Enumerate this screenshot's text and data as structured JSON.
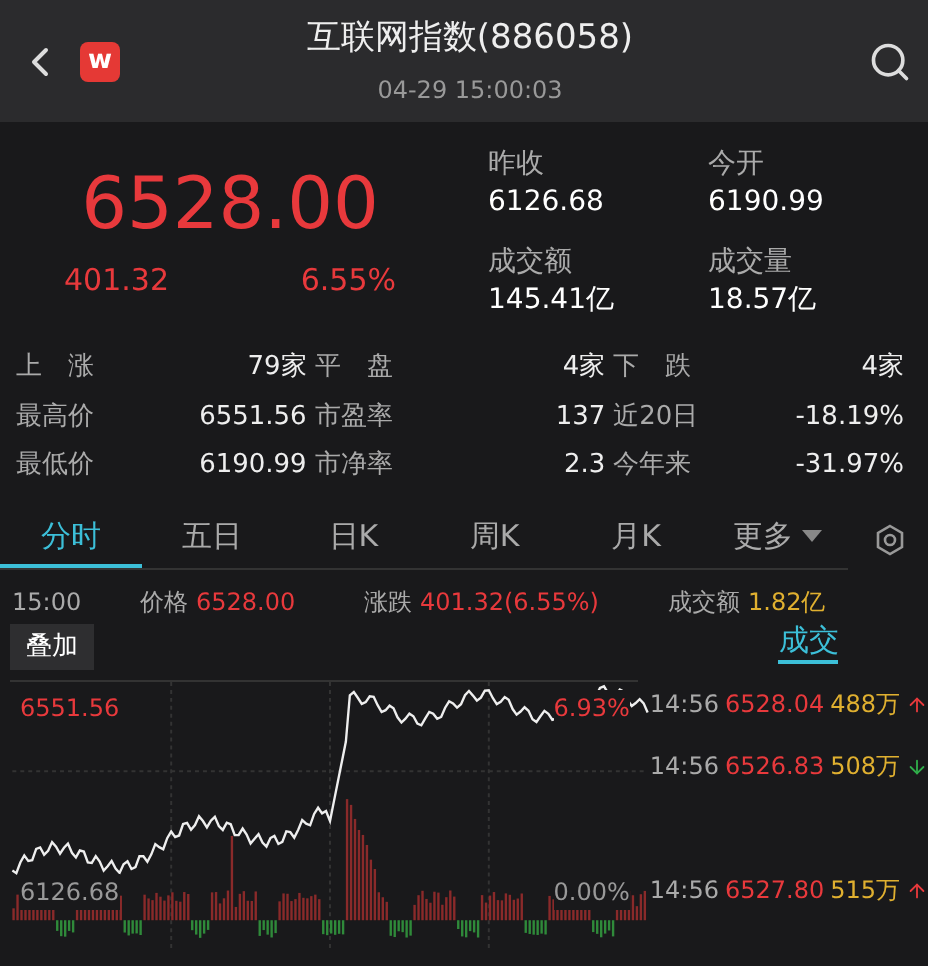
{
  "header": {
    "logo": "w",
    "title": "互联网指数(886058)",
    "time": "04-29 15:00:03"
  },
  "quote": {
    "price": "6528.00",
    "change": "401.32",
    "percent": "6.55%"
  },
  "summary": [
    {
      "label": "昨收",
      "value": "6126.68"
    },
    {
      "label": "今开",
      "value": "6190.99"
    },
    {
      "label": "成交额",
      "value": "145.41亿"
    },
    {
      "label": "成交量",
      "value": "18.57亿"
    }
  ],
  "stats": [
    [
      {
        "label": "上　涨",
        "value": "79家"
      },
      {
        "label": "平　盘",
        "value": "4家"
      },
      {
        "label": "下　跌",
        "value": "4家"
      }
    ],
    [
      {
        "label": "最高价",
        "value": "6551.56"
      },
      {
        "label": "市盈率",
        "value": "137"
      },
      {
        "label": "近20日",
        "value": "-18.19%"
      }
    ],
    [
      {
        "label": "最低价",
        "value": "6190.99"
      },
      {
        "label": "市净率",
        "value": "2.3"
      },
      {
        "label": "今年来",
        "value": "-31.97%"
      }
    ]
  ],
  "tabs": [
    {
      "label": "分时",
      "selected": true
    },
    {
      "label": "五日",
      "selected": false
    },
    {
      "label": "日K",
      "selected": false
    },
    {
      "label": "周K",
      "selected": false
    },
    {
      "label": "月K",
      "selected": false
    },
    {
      "label": "更多",
      "selected": false,
      "dropdown": true
    }
  ],
  "info": {
    "time": "15:00",
    "price_label": "价格",
    "price": "6528.00",
    "change_label": "涨跌",
    "change": "401.32(6.55%)",
    "amount_label": "成交额",
    "amount": "1.82亿"
  },
  "overlay_button": "叠加",
  "chart": {
    "high": "6551.56",
    "low": "6126.68",
    "high_pct": "6.93%",
    "low_pct": "0.00%"
  },
  "side_tab": {
    "label": "成交",
    "selected": true
  },
  "trades": [
    {
      "time": "14:56",
      "price": "6528.04",
      "volume": "488万",
      "kind": "up"
    },
    {
      "time": "14:56",
      "price": "6526.83",
      "volume": "508万",
      "kind": "down"
    },
    {
      "time": "14:56",
      "price": "6527.80",
      "volume": "515万",
      "kind": "up"
    }
  ]
}
